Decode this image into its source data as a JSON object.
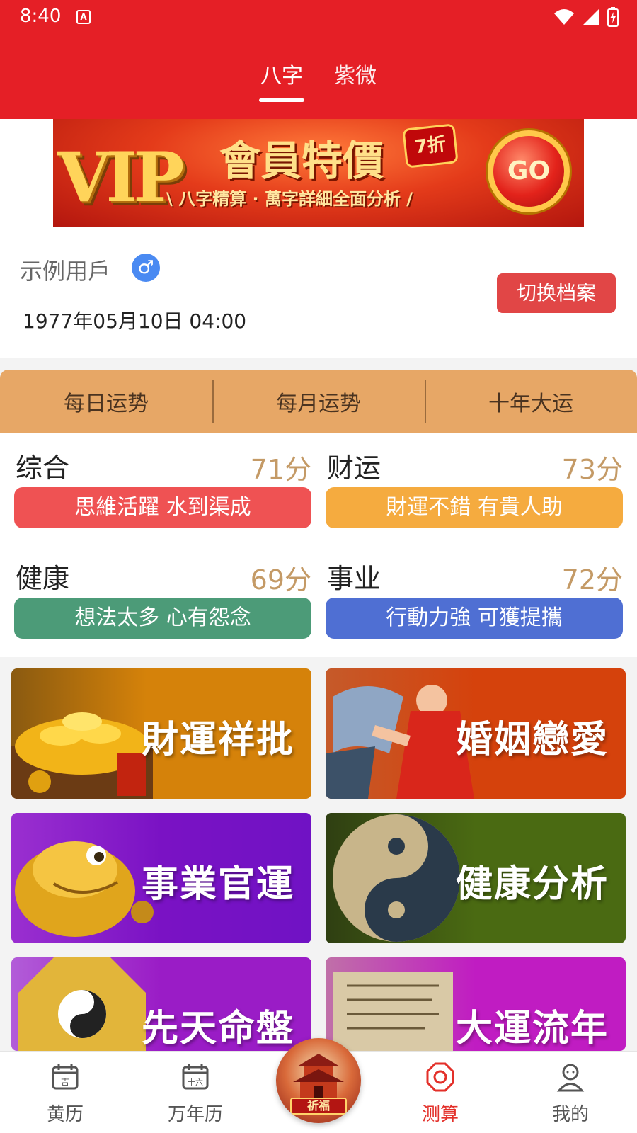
{
  "status_bar": {
    "time": "8:40",
    "notification_icon": "A"
  },
  "header": {
    "tabs": [
      {
        "label": "八字",
        "active": true
      },
      {
        "label": "紫微",
        "active": false
      }
    ]
  },
  "vip_banner": {
    "big_text": "VIP",
    "title": "會員特價",
    "badge": "7折",
    "subtitle": "\\ 八字精算 · 萬字詳細全面分析 /",
    "go_label": "GO"
  },
  "profile": {
    "name": "示例用戶",
    "gender_icon": "male-icon",
    "birth": "1977年05月10日 04:00",
    "switch_label": "切换档案"
  },
  "fortune_tabs": [
    "每日运势",
    "每月运势",
    "十年大运"
  ],
  "scores": [
    {
      "title": "综合",
      "value": "71分",
      "summary": "思維活躍 水到渠成",
      "color": "#ef5253"
    },
    {
      "title": "财运",
      "value": "73分",
      "summary": "財運不錯 有貴人助",
      "color": "#f5ab3f"
    },
    {
      "title": "健康",
      "value": "69分",
      "summary": "想法太多 心有怨念",
      "color": "#4c9b78"
    },
    {
      "title": "事业",
      "value": "72分",
      "summary": "行動力強 可獲提攜",
      "color": "#4f6fd3"
    }
  ],
  "cards": [
    {
      "label": "財運祥批",
      "color": "#d5820a"
    },
    {
      "label": "婚姻戀愛",
      "color": "#d5420c"
    },
    {
      "label": "事業官運",
      "color": "#7a12c4"
    },
    {
      "label": "健康分析",
      "color": "#4a6a12"
    },
    {
      "label": "先天命盤",
      "color": "#9a1cc6"
    },
    {
      "label": "大運流年",
      "color": "#c01cc2"
    }
  ],
  "bottom_nav": {
    "items": [
      {
        "label": "黄历",
        "active": false
      },
      {
        "label": "万年历",
        "active": false
      },
      {
        "label": "测算",
        "active": true
      },
      {
        "label": "我的",
        "active": false
      }
    ],
    "center_label": "祈福"
  }
}
